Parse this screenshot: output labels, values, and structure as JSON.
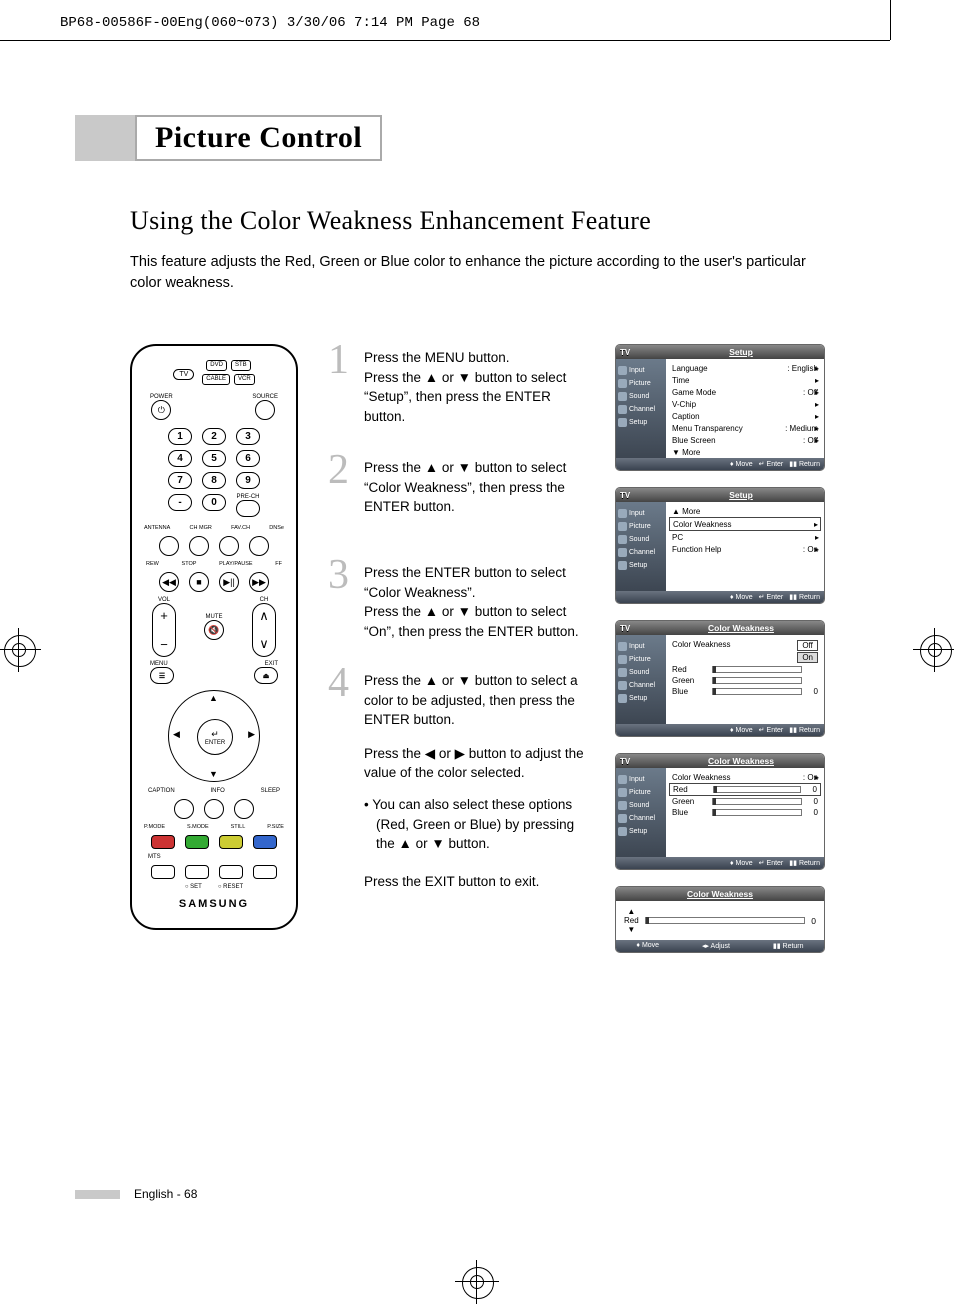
{
  "print_header": "BP68-00586F-00Eng(060~073)  3/30/06  7:14 PM  Page 68",
  "title": "Picture Control",
  "section_heading": "Using the Color Weakness Enhancement Feature",
  "intro": "This feature adjusts the Red, Green or Blue color to enhance the picture according to the user's particular color weakness.",
  "remote": {
    "sources_top": [
      "DVD",
      "STB"
    ],
    "sources_bottom": [
      "CABLE",
      "VCR"
    ],
    "tv": "TV",
    "power": "POWER",
    "source": "SOURCE",
    "digits": [
      "1",
      "2",
      "3",
      "4",
      "5",
      "6",
      "7",
      "8",
      "9",
      "-",
      "0"
    ],
    "pre_ch": "PRE-CH",
    "bottom_labels": [
      "ANTENNA",
      "CH MGR",
      "FAV.CH",
      "DNSe"
    ],
    "transport": [
      "REW",
      "STOP",
      "PLAY/PAUSE",
      "FF"
    ],
    "vol": "VOL",
    "ch": "CH",
    "mute": "MUTE",
    "menu": "MENU",
    "exit": "EXIT",
    "enter": "ENTER",
    "row_a": [
      "CAPTION",
      "INFO",
      "SLEEP"
    ],
    "row_b": [
      "P.MODE",
      "S.MODE",
      "STILL",
      "P.SIZE"
    ],
    "mts": "MTS",
    "set": "SET",
    "reset": "RESET",
    "brand": "SAMSUNG"
  },
  "steps": {
    "1": "Press the MENU button.\nPress the ▲ or ▼ button to select “Setup”, then press the ENTER button.",
    "2": "Press the ▲ or ▼ button to select “Color Weakness”, then press the ENTER button.",
    "3": "Press the ENTER button to select “Color Weakness”.\nPress the ▲ or ▼ button to select “On”, then press the ENTER button.",
    "4a": "Press the ▲ or ▼ button to select a color to be adjusted, then press the ENTER button.",
    "4b": "Press the ◀ or ▶ button to adjust the value of the color selected.",
    "4c": "• You can also select these options (Red, Green or Blue) by pressing the ▲ or ▼ button.",
    "exit": "Press the EXIT button to exit."
  },
  "osd": {
    "tv": "TV",
    "side": [
      {
        "icon": "input",
        "label": "Input"
      },
      {
        "icon": "picture",
        "label": "Picture"
      },
      {
        "icon": "sound",
        "label": "Sound"
      },
      {
        "icon": "channel",
        "label": "Channel"
      },
      {
        "icon": "setup",
        "label": "Setup"
      }
    ],
    "foot": {
      "move": "Move",
      "enter": "Enter",
      "return": "Return",
      "adjust": "Adjust"
    },
    "screen1": {
      "title": "Setup",
      "items": [
        {
          "label": "Language",
          "value": ": English",
          "arrow": true
        },
        {
          "label": "Time",
          "value": "",
          "arrow": true
        },
        {
          "label": "Game Mode",
          "value": ": Off",
          "arrow": true
        },
        {
          "label": "V-Chip",
          "value": "",
          "arrow": true
        },
        {
          "label": "Caption",
          "value": "",
          "arrow": true
        },
        {
          "label": "Menu Transparency",
          "value": ": Medium",
          "arrow": true
        },
        {
          "label": "Blue Screen",
          "value": ": Off",
          "arrow": true
        },
        {
          "label": "▼ More",
          "value": "",
          "arrow": false
        }
      ]
    },
    "screen2": {
      "title": "Setup",
      "items": [
        {
          "label": "▲ More",
          "value": "",
          "arrow": false,
          "boxed": false
        },
        {
          "label": "Color Weakness",
          "value": "",
          "arrow": true,
          "boxed": true
        },
        {
          "label": "PC",
          "value": "",
          "arrow": true,
          "boxed": false
        },
        {
          "label": "Function Help",
          "value": ": On",
          "arrow": true,
          "boxed": false
        }
      ]
    },
    "screen3": {
      "title": "Color Weakness",
      "cw_label": "Color Weakness",
      "off": "Off",
      "on": "On",
      "colors": [
        {
          "name": "Red",
          "val": ""
        },
        {
          "name": "Green",
          "val": ""
        },
        {
          "name": "Blue",
          "val": "0"
        }
      ]
    },
    "screen4": {
      "title": "Color Weakness",
      "cw_label": "Color Weakness",
      "cw_value": ": On",
      "colors": [
        {
          "name": "Red",
          "val": "0",
          "boxed": true
        },
        {
          "name": "Green",
          "val": "0",
          "boxed": false
        },
        {
          "name": "Blue",
          "val": "0",
          "boxed": false
        }
      ]
    },
    "adjust": {
      "title": "Color Weakness",
      "label": "Red",
      "value": "0"
    }
  },
  "footer": "English - 68"
}
